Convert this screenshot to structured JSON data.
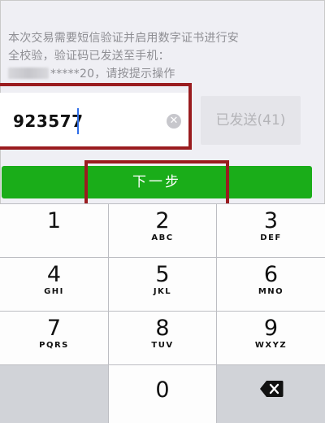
{
  "info": {
    "line1": "本次交易需要短信验证并启用数字证书进行安",
    "line2": "全校验，验证码已发送至手机：",
    "phone_visible": "*****20，请按提示操作"
  },
  "code_input": {
    "value": "923577"
  },
  "send_button": {
    "label": "已发送(41)"
  },
  "next_button": {
    "label": "下一步"
  },
  "keypad": {
    "keys": [
      {
        "digit": "1",
        "letters": ""
      },
      {
        "digit": "2",
        "letters": "ABC"
      },
      {
        "digit": "3",
        "letters": "DEF"
      },
      {
        "digit": "4",
        "letters": "GHI"
      },
      {
        "digit": "5",
        "letters": "JKL"
      },
      {
        "digit": "6",
        "letters": "MNO"
      },
      {
        "digit": "7",
        "letters": "PQRS"
      },
      {
        "digit": "8",
        "letters": "TUV"
      },
      {
        "digit": "9",
        "letters": "WXYZ"
      },
      {
        "digit": "0",
        "letters": ""
      }
    ]
  },
  "icons": {
    "clear": "clear-icon",
    "backspace": "backspace-icon"
  },
  "colors": {
    "accent": "#1aad19",
    "highlight": "#9a1c1f"
  }
}
